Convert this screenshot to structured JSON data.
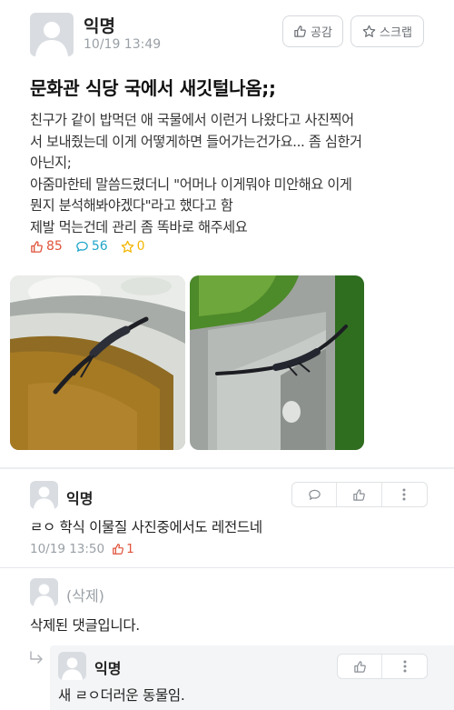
{
  "post": {
    "author": "익명",
    "time": "10/19 13:49",
    "like_button_label": "공감",
    "scrap_button_label": "스크랩",
    "title": "문화관 식당 국에서 새깃털나옴;;",
    "body_lines": [
      "친구가 같이 밥먹던 애 국물에서 이런거 나왔다고 사진찍어",
      "서 보내줬는데 이게 어떻게하면 들어가는건가요... 좀 심한거",
      "아닌지;",
      "아줌마한테 말씀드렸더니 \"어머나 이게뭐야 미안해요 이게",
      "뭔지 분석해봐야겠다\"라고 했다고 함",
      "제발 먹는건데 관리 좀 똑바로 해주세요"
    ],
    "likes": "85",
    "comments": "56",
    "scraps": "0"
  },
  "comments": [
    {
      "author": "익명",
      "text": "ㄹㅇ 학식 이물질 사진중에서도 레전드네",
      "time": "10/19 13:50",
      "likes": "1"
    },
    {
      "author": "(삭제)",
      "text": "삭제된 댓글입니다."
    }
  ],
  "reply": {
    "author": "익명",
    "text": "새 ㄹㅇ더러운 동물임."
  },
  "colors": {
    "like": "#e0533b",
    "comment": "#1fa6c9",
    "scrap": "#f2b705",
    "muted": "#9aa0a6"
  },
  "icons": [
    "person-icon",
    "thumbs-up-icon",
    "star-icon",
    "speech-bubble-icon",
    "more-vertical-icon",
    "reply-arrow-icon"
  ]
}
